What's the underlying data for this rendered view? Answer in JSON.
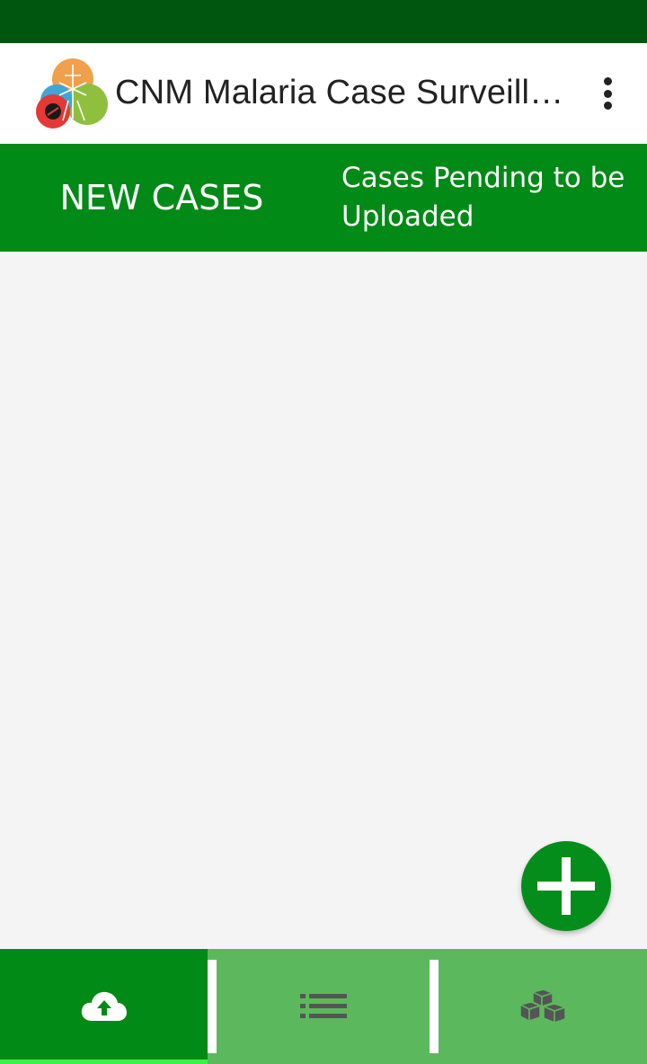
{
  "app_bar": {
    "title": "CNM Malaria Case Surveillance",
    "logo_icon": "malaria-mosquito-logo",
    "menu_icon": "more-vertical-icon"
  },
  "tabs": [
    {
      "label": "NEW CASES",
      "selected": true
    },
    {
      "label": "Cases Pending to be Uploaded",
      "selected": false
    }
  ],
  "fab": {
    "icon": "plus-icon"
  },
  "bottom_nav": [
    {
      "icon": "cloud-upload-icon",
      "selected": true
    },
    {
      "icon": "list-icon",
      "selected": false
    },
    {
      "icon": "boxes-icon",
      "selected": false
    }
  ],
  "colors": {
    "status_bar": "#00560f",
    "primary": "#018a15",
    "nav_inactive": "#5cb85c",
    "indicator": "#3cf04a",
    "background": "#f4f4f4"
  }
}
